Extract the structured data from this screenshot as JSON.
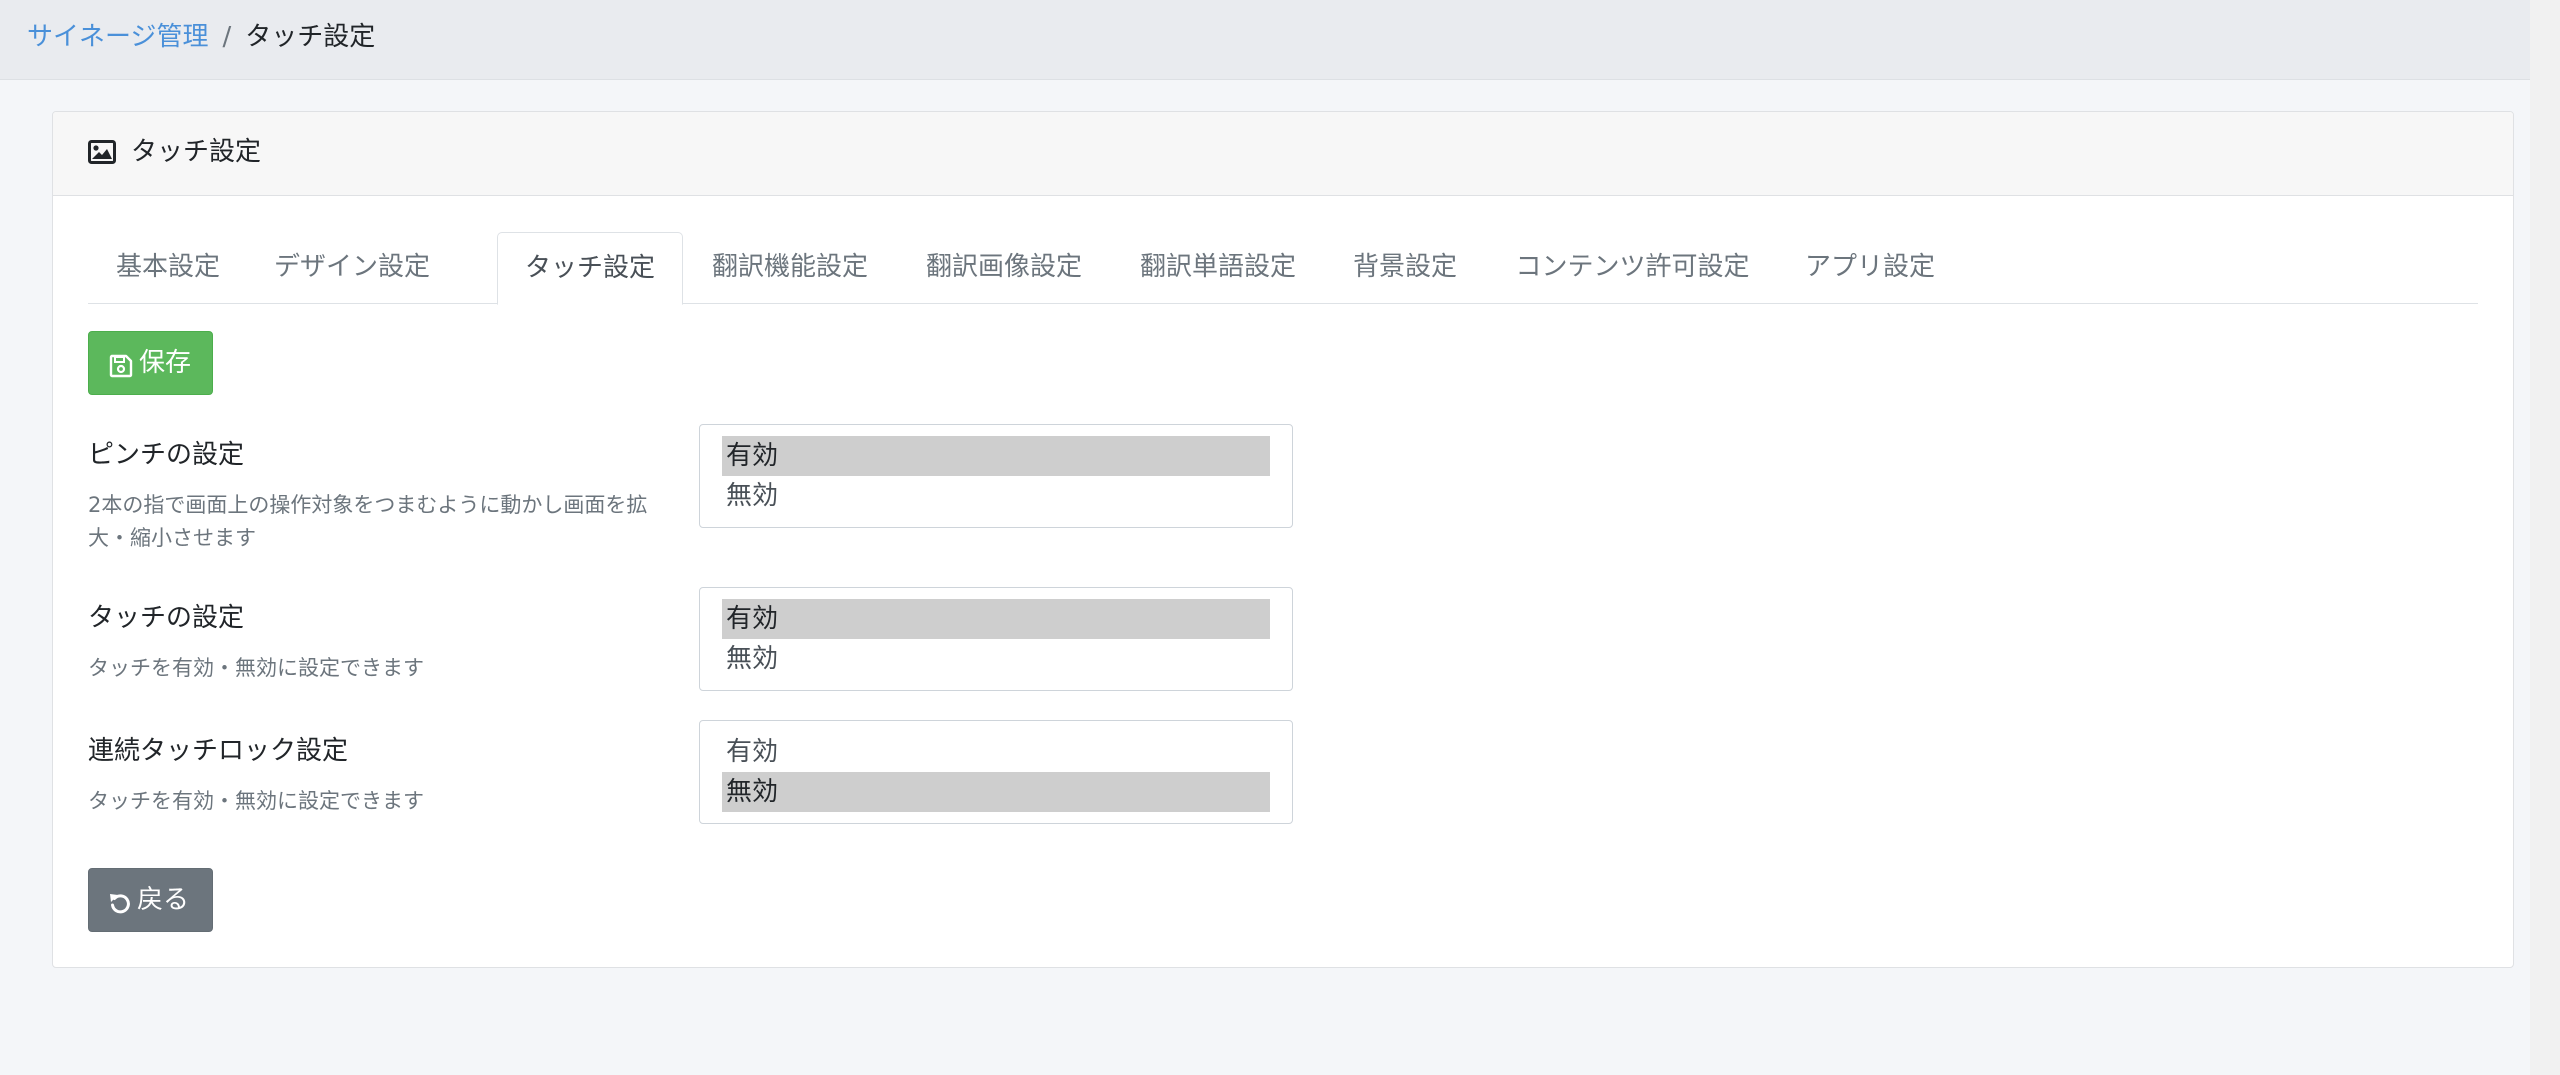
{
  "breadcrumb": {
    "parent": "サイネージ管理",
    "separator": "/",
    "current": "タッチ設定"
  },
  "card": {
    "title": "タッチ設定",
    "icon": "image-icon"
  },
  "tabs": [
    {
      "label": "基本設定",
      "active": false
    },
    {
      "label": "デザイン設定",
      "active": false
    },
    {
      "label": "タッチ設定",
      "active": true
    },
    {
      "label": "翻訳機能設定",
      "active": false
    },
    {
      "label": "翻訳画像設定",
      "active": false
    },
    {
      "label": "翻訳単語設定",
      "active": false
    },
    {
      "label": "背景設定",
      "active": false
    },
    {
      "label": "コンテンツ許可設定",
      "active": false
    },
    {
      "label": "アプリ設定",
      "active": false
    }
  ],
  "buttons": {
    "save": {
      "label": "保存",
      "icon": "save-icon",
      "color": "#5cb85c"
    },
    "back": {
      "label": "戻る",
      "icon": "undo-icon",
      "color": "#6c757d"
    }
  },
  "settings": [
    {
      "label": "ピンチの設定",
      "description": "2本の指で画面上の操作対象をつまむように動かし画面を拡大・縮小させます",
      "options": [
        "有効",
        "無効"
      ],
      "selected": "有効"
    },
    {
      "label": "タッチの設定",
      "description": "タッチを有効・無効に設定できます",
      "options": [
        "有効",
        "無効"
      ],
      "selected": "有効"
    },
    {
      "label": "連続タッチロック設定",
      "description": "タッチを有効・無効に設定できます",
      "options": [
        "有効",
        "無効"
      ],
      "selected": "無効"
    }
  ],
  "colors": {
    "link": "#4a90d9",
    "selected_option_bg": "#cecece"
  }
}
